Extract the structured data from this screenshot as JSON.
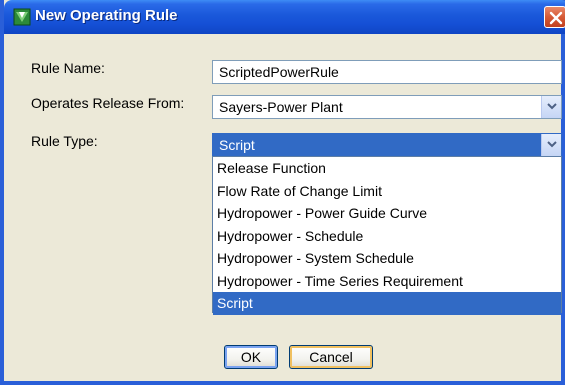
{
  "dialog": {
    "title": "New Operating Rule",
    "close_label": "close"
  },
  "form": {
    "rule_name_label": "Rule Name:",
    "rule_name_value": "ScriptedPowerRule",
    "operates_label": "Operates Release From:",
    "operates_value": "Sayers-Power Plant",
    "rule_type_label": "Rule Type:",
    "rule_type_value": "Script"
  },
  "rule_type_options": [
    "Release Function",
    "Flow Rate of Change Limit",
    "Hydropower - Power Guide Curve",
    "Hydropower - Schedule",
    "Hydropower - System Schedule",
    "Hydropower - Time Series Requirement",
    "Script"
  ],
  "buttons": {
    "ok": "OK",
    "cancel": "Cancel"
  },
  "colors": {
    "titlebar": "#1550d6",
    "selection": "#316ac5",
    "dialog_bg": "#ece9d8"
  }
}
